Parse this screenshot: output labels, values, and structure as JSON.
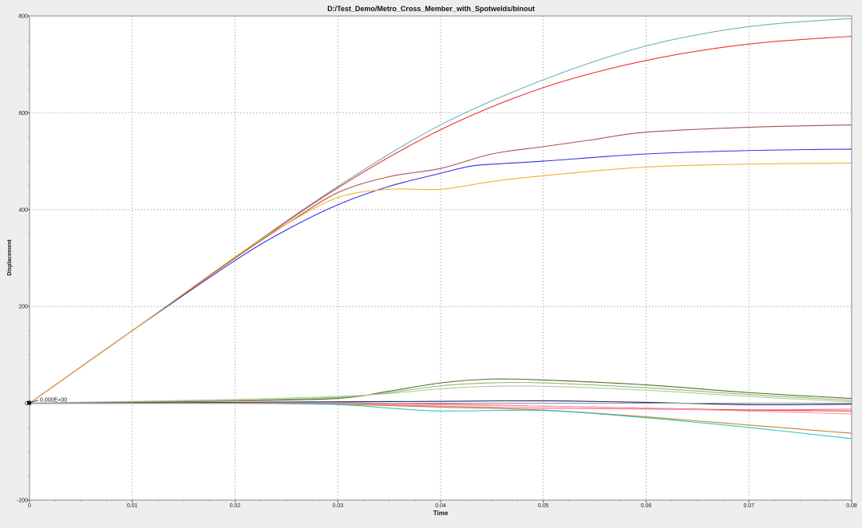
{
  "window": {
    "title": "D:/Test_Demo/Metro_Cross_Member_with_Spotwelds/binout"
  },
  "chart_data": {
    "type": "line",
    "title": "D:/Test_Demo/Metro_Cross_Member_with_Spotwelds/binout",
    "xlabel": "Time",
    "ylabel": "Displacement",
    "xlim": [
      0,
      0.08
    ],
    "ylim": [
      -200,
      800
    ],
    "x_ticks": [
      "0",
      "0.01",
      "0.02",
      "0.03",
      "0.04",
      "0.05",
      "0.06",
      "0.07",
      "0.08"
    ],
    "y_ticks": [
      "-200",
      "0",
      "200",
      "400",
      "600",
      "800"
    ],
    "grid": true,
    "annotation": {
      "text": "0.000E+00",
      "x": 0,
      "y": 0
    },
    "colors": {
      "background": "#ffffff",
      "grid": "#9a9a9a",
      "frame": "#8a8a8a"
    },
    "series": [
      {
        "color": "#6fb3b3",
        "x": [
          0,
          0.01,
          0.02,
          0.03,
          0.04,
          0.05,
          0.06,
          0.07,
          0.08
        ],
        "y": [
          0,
          150,
          302,
          448,
          575,
          668,
          738,
          778,
          795
        ]
      },
      {
        "color": "#ee3333",
        "x": [
          0,
          0.01,
          0.02,
          0.03,
          0.04,
          0.05,
          0.06,
          0.07,
          0.08
        ],
        "y": [
          0,
          150,
          300,
          445,
          565,
          652,
          708,
          742,
          758
        ]
      },
      {
        "color": "#a8524c",
        "x": [
          0,
          0.01,
          0.02,
          0.025,
          0.03,
          0.035,
          0.04,
          0.045,
          0.05,
          0.055,
          0.06,
          0.07,
          0.08
        ],
        "y": [
          0,
          150,
          300,
          370,
          435,
          468,
          485,
          515,
          530,
          545,
          560,
          570,
          575
        ]
      },
      {
        "color": "#3333ee",
        "x": [
          0,
          0.01,
          0.02,
          0.025,
          0.03,
          0.035,
          0.04,
          0.043,
          0.046,
          0.05,
          0.06,
          0.07,
          0.08
        ],
        "y": [
          0,
          150,
          295,
          358,
          410,
          448,
          475,
          490,
          495,
          500,
          515,
          522,
          525
        ]
      },
      {
        "color": "#f0b030",
        "x": [
          0,
          0.01,
          0.02,
          0.025,
          0.03,
          0.035,
          0.04,
          0.045,
          0.05,
          0.06,
          0.07,
          0.08
        ],
        "y": [
          0,
          150,
          302,
          370,
          425,
          442,
          442,
          458,
          470,
          488,
          494,
          496
        ]
      },
      {
        "color": "#556b2f",
        "x": [
          0,
          0.01,
          0.02,
          0.03,
          0.035,
          0.04,
          0.045,
          0.05,
          0.06,
          0.07,
          0.08
        ],
        "y": [
          0,
          2,
          5,
          10,
          25,
          42,
          50,
          48,
          38,
          22,
          10
        ]
      },
      {
        "color": "#8fbc6a",
        "x": [
          0,
          0.01,
          0.02,
          0.03,
          0.035,
          0.04,
          0.045,
          0.05,
          0.06,
          0.07,
          0.08
        ],
        "y": [
          0,
          3,
          6,
          12,
          22,
          36,
          42,
          42,
          32,
          18,
          6
        ]
      },
      {
        "color": "#b5c9a0",
        "x": [
          0,
          0.01,
          0.02,
          0.03,
          0.035,
          0.04,
          0.045,
          0.05,
          0.06,
          0.07,
          0.08
        ],
        "y": [
          0,
          4,
          8,
          14,
          20,
          30,
          35,
          35,
          27,
          14,
          3
        ]
      },
      {
        "color": "#222266",
        "x": [
          0,
          0.01,
          0.02,
          0.03,
          0.04,
          0.05,
          0.06,
          0.07,
          0.08
        ],
        "y": [
          0,
          1,
          2,
          3,
          4,
          5,
          2,
          -3,
          -2
        ]
      },
      {
        "color": "#ff66aa",
        "x": [
          0,
          0.01,
          0.02,
          0.03,
          0.04,
          0.05,
          0.06,
          0.07,
          0.08
        ],
        "y": [
          0,
          0,
          1,
          0,
          -6,
          -10,
          -12,
          -14,
          -12
        ]
      },
      {
        "color": "#ee3333",
        "x": [
          0,
          0.01,
          0.02,
          0.03,
          0.04,
          0.05,
          0.06,
          0.07,
          0.08
        ],
        "y": [
          0,
          0,
          1,
          1,
          -2,
          -6,
          -10,
          -14,
          -16
        ]
      },
      {
        "color": "#f4a0a0",
        "x": [
          0,
          0.01,
          0.02,
          0.03,
          0.04,
          0.05,
          0.06,
          0.07,
          0.08
        ],
        "y": [
          0,
          0,
          0,
          1,
          -3,
          -6,
          -10,
          -16,
          -22
        ]
      },
      {
        "color": "#d08030",
        "x": [
          0,
          0.01,
          0.02,
          0.03,
          0.04,
          0.05,
          0.06,
          0.07,
          0.08
        ],
        "y": [
          0,
          0,
          0,
          -2,
          -8,
          -14,
          -28,
          -45,
          -62
        ]
      },
      {
        "color": "#30c8c8",
        "x": [
          0,
          0.01,
          0.02,
          0.03,
          0.035,
          0.04,
          0.05,
          0.06,
          0.07,
          0.08
        ],
        "y": [
          0,
          0,
          0,
          -3,
          -10,
          -16,
          -15,
          -30,
          -50,
          -73
        ]
      },
      {
        "color": "#9a9a9a",
        "x": [
          0,
          0.01,
          0.02,
          0.03,
          0.04,
          0.05,
          0.06,
          0.07,
          0.08
        ],
        "y": [
          0,
          0,
          0,
          0,
          0,
          0,
          0,
          0,
          0
        ]
      }
    ]
  }
}
